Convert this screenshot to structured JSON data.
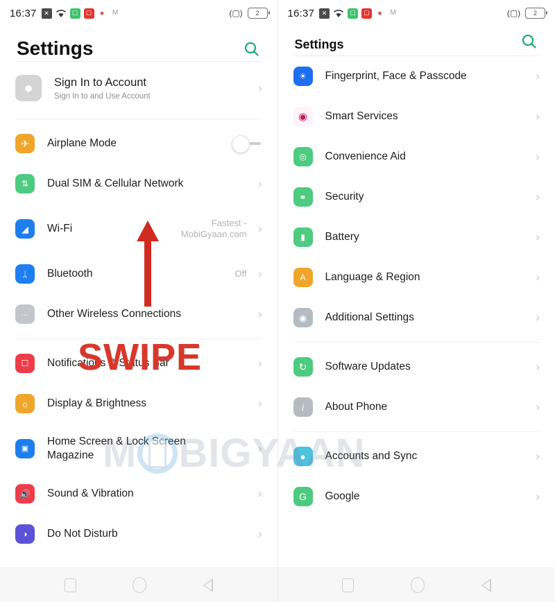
{
  "statusbar": {
    "time": "16:37",
    "icons": [
      "x-badge-icon",
      "wifi-icon",
      "green-app-icon",
      "red-app-icon",
      "person-app-icon",
      "gmail-icon"
    ],
    "vibrate_icon": "vibrate-icon",
    "battery_level": "2"
  },
  "colors": {
    "accent_search": "#1faa73",
    "annotation_red": "#d8372b",
    "chevron": "#c6c6c6",
    "value_text": "#b3b3b3"
  },
  "left_screen": {
    "header": {
      "title": "Settings",
      "search_icon": "search-icon"
    },
    "account": {
      "title": "Sign In to Account",
      "subtitle": "Sign In to and Use Account",
      "avatar_icon": "person-avatar-icon",
      "chevron": "›"
    },
    "items": [
      {
        "label": "Airplane Mode",
        "icon": "airplane-icon",
        "icon_glyph": "✈",
        "icon_color": "#f0a62b",
        "control": "toggle",
        "toggle_on": false
      },
      {
        "label": "Dual SIM & Cellular Network",
        "icon": "sim-card-icon",
        "icon_glyph": "⇅",
        "icon_color": "#4dcb80",
        "control": "chevron",
        "chevron": "›"
      },
      {
        "label": "Wi-Fi",
        "icon": "wifi-icon",
        "icon_glyph": "●",
        "icon_color": "#1d7ef0",
        "control": "chevron",
        "chevron": "›",
        "value": "Fastest -\nMobiGyaan.com"
      },
      {
        "label": "Bluetooth",
        "icon": "bluetooth-icon",
        "icon_glyph": "ᛦ",
        "icon_color": "#1d7ef0",
        "control": "chevron",
        "chevron": "›",
        "value": "Off"
      },
      {
        "label": "Other Wireless Connections",
        "icon": "ellipsis-icon",
        "icon_glyph": "•••",
        "icon_color": "#c3c7cc",
        "control": "chevron",
        "chevron": "›"
      }
    ],
    "items2": [
      {
        "label": "Notifications & Status Bar",
        "icon": "notifications-icon",
        "icon_glyph": "▢",
        "icon_color": "#ed3d4a",
        "control": "chevron",
        "chevron": "›"
      },
      {
        "label": "Display & Brightness",
        "icon": "brightness-icon",
        "icon_glyph": "☀",
        "icon_color": "#f0a62b",
        "control": "chevron",
        "chevron": "›"
      },
      {
        "label": "Home Screen & Lock Screen Magazine",
        "icon": "home-screen-icon",
        "icon_glyph": "▣",
        "icon_color": "#1d7ef0",
        "control": "chevron",
        "chevron": "›",
        "two_line": true
      },
      {
        "label": "Sound & Vibration",
        "icon": "sound-icon",
        "icon_glyph": "◂",
        "icon_color": "#ed3d4a",
        "control": "chevron",
        "chevron": "›"
      },
      {
        "label": "Do Not Disturb",
        "icon": "do-not-disturb-icon",
        "icon_glyph": "◑",
        "icon_color": "#5b52d6",
        "control": "chevron",
        "chevron": "›",
        "clipped": true
      }
    ],
    "annotations": {
      "swipe_label": "SWIPE",
      "arrow": "up-arrow-annotation"
    },
    "navbar": {
      "recents": "recents-square-icon",
      "home": "home-circle-icon",
      "back": "back-triangle-icon"
    }
  },
  "right_screen": {
    "header": {
      "title": "Settings",
      "search_icon": "search-icon"
    },
    "items": [
      {
        "label": "Fingerprint, Face & Passcode",
        "icon": "fingerprint-face-icon",
        "icon_glyph": "◔",
        "icon_color": "#1d6ef0",
        "chevron": "›"
      },
      {
        "label": "Smart Services",
        "icon": "smart-services-icon",
        "icon_glyph": "◉",
        "icon_color": "#ffffff",
        "chevron": "›"
      },
      {
        "label": "Convenience Aid",
        "icon": "convenience-aid-icon",
        "icon_glyph": "◎",
        "icon_color": "#4dcb80",
        "chevron": "›"
      },
      {
        "label": "Security",
        "icon": "security-shield-icon",
        "icon_glyph": "⛨",
        "icon_color": "#4dcb80",
        "chevron": "›"
      },
      {
        "label": "Battery",
        "icon": "battery-icon",
        "icon_glyph": "▮",
        "icon_color": "#4dcb80",
        "chevron": "›"
      },
      {
        "label": "Language & Region",
        "icon": "language-icon",
        "icon_glyph": "A",
        "icon_color": "#f0a62b",
        "chevron": "›"
      },
      {
        "label": "Additional Settings",
        "icon": "additional-settings-icon",
        "icon_glyph": "◉",
        "icon_color": "#b6bac2",
        "chevron": "›"
      }
    ],
    "items2": [
      {
        "label": "Software Updates",
        "icon": "software-updates-icon",
        "icon_glyph": "↻",
        "icon_color": "#4dcb80",
        "chevron": "›"
      },
      {
        "label": "About Phone",
        "icon": "about-phone-icon",
        "icon_glyph": "i",
        "icon_color": "#b6bac2",
        "chevron": "›"
      }
    ],
    "items3": [
      {
        "label": "Accounts and Sync",
        "icon": "accounts-sync-icon",
        "icon_glyph": "●",
        "icon_color": "#4ec3e0",
        "chevron": "›"
      },
      {
        "label": "Google",
        "icon": "google-icon",
        "icon_glyph": "G",
        "icon_color": "#4dcb80",
        "chevron": "›"
      }
    ],
    "annotations": {
      "arrow": "left-arrow-annotation"
    },
    "navbar": {
      "recents": "recents-square-icon",
      "home": "home-circle-icon",
      "back": "back-triangle-icon"
    }
  },
  "watermark": {
    "before": "M",
    "after": "BIGYAAN"
  }
}
